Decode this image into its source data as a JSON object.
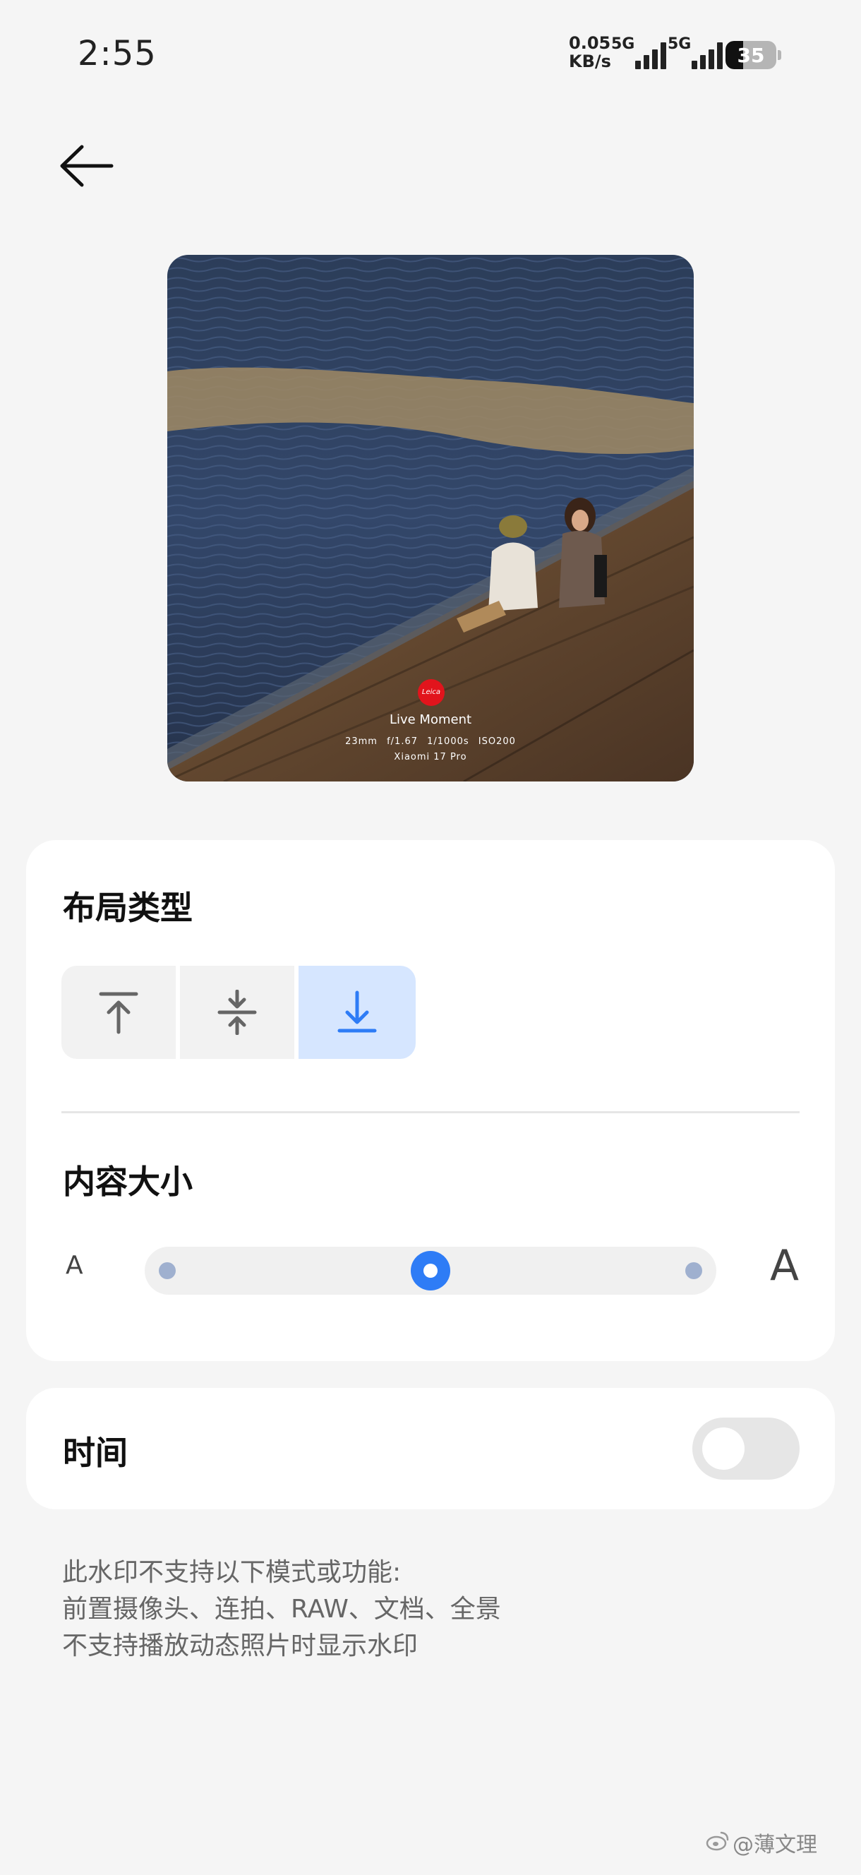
{
  "status_bar": {
    "time": "2:55",
    "net_speed_value": "0.05",
    "net_speed_unit": "KB/s",
    "sim1_label": "5G",
    "sim2_label": "5G",
    "battery_level": "35"
  },
  "preview": {
    "watermark_brand_icon": "leica-red-dot-logo",
    "watermark_title": "Live Moment",
    "watermark_params": "23mm f/1.67 1/1000s ISO200",
    "watermark_device": "Xiaomi 17 Pro"
  },
  "layout_section": {
    "title": "布局类型",
    "options": [
      {
        "icon": "align-top-icon",
        "selected": false
      },
      {
        "icon": "align-center-icon",
        "selected": false
      },
      {
        "icon": "align-bottom-icon",
        "selected": true
      }
    ]
  },
  "size_section": {
    "title": "内容大小",
    "small_label": "A",
    "large_label": "A",
    "slider_steps": 3,
    "slider_value_index": 1
  },
  "time_section": {
    "label": "时间",
    "enabled": false
  },
  "notes": [
    "此水印不支持以下模式或功能:",
    "前置摄像头、连拍、RAW、文档、全景",
    "不支持播放动态照片时显示水印"
  ],
  "credit": "@薄文理",
  "colors": {
    "accent": "#2e7cf6",
    "selected_bg": "#d6e6ff",
    "card_bg": "#ffffff",
    "page_bg": "#f5f5f5",
    "leica_red": "#e2141c"
  }
}
